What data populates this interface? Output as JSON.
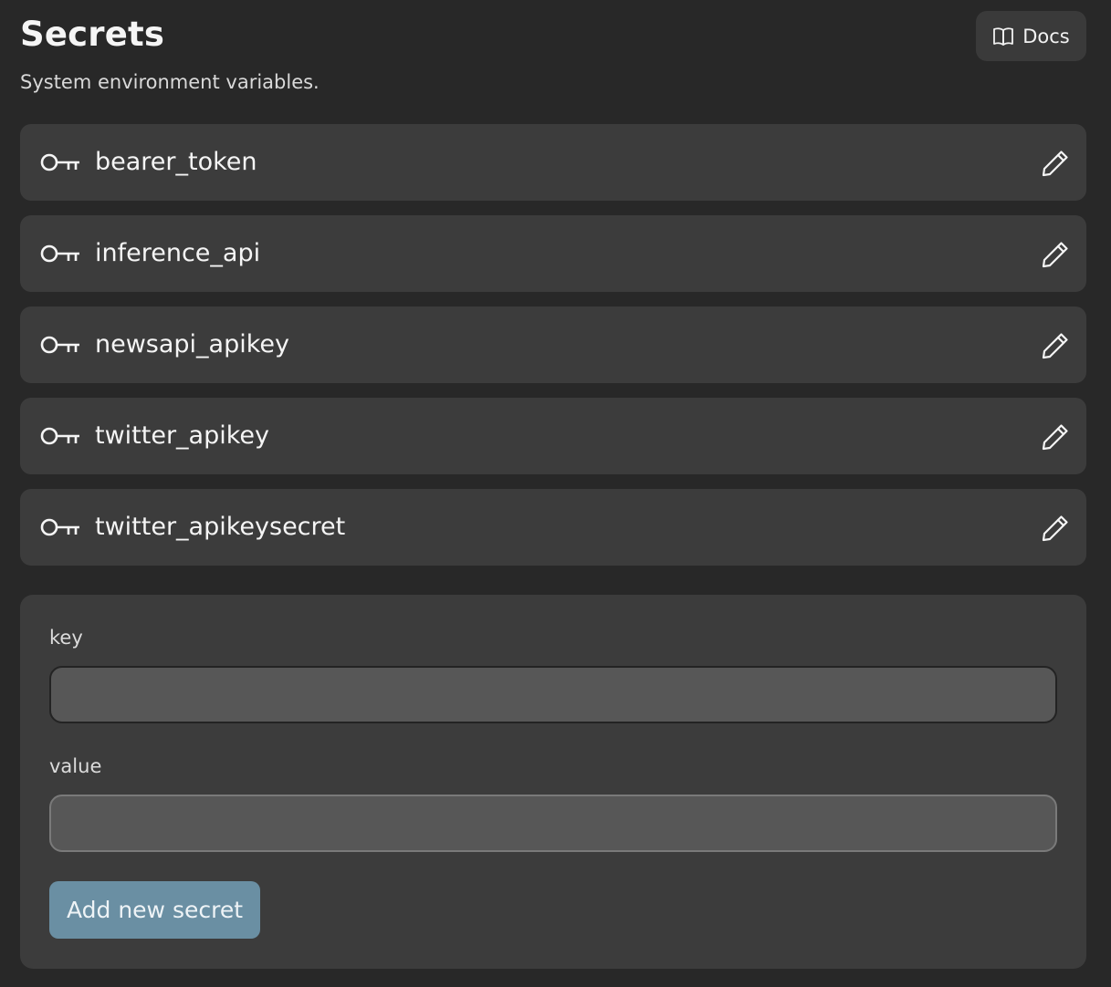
{
  "header": {
    "title": "Secrets",
    "subtitle": "System environment variables.",
    "docs_label": "Docs",
    "docs_icon": "book-open-icon"
  },
  "secrets": [
    {
      "name": "bearer_token",
      "icon": "key-icon",
      "action_icon": "pencil-icon"
    },
    {
      "name": "inference_api",
      "icon": "key-icon",
      "action_icon": "pencil-icon"
    },
    {
      "name": "newsapi_apikey",
      "icon": "key-icon",
      "action_icon": "pencil-icon"
    },
    {
      "name": "twitter_apikey",
      "icon": "key-icon",
      "action_icon": "pencil-icon"
    },
    {
      "name": "twitter_apikeysecret",
      "icon": "key-icon",
      "action_icon": "pencil-icon"
    }
  ],
  "form": {
    "key_label": "key",
    "key_value": "",
    "value_label": "value",
    "value_value": "",
    "submit_label": "Add new secret"
  },
  "colors": {
    "background": "#282828",
    "card": "#3c3c3c",
    "input": "#575757",
    "primary_button": "#6a8fa3"
  }
}
